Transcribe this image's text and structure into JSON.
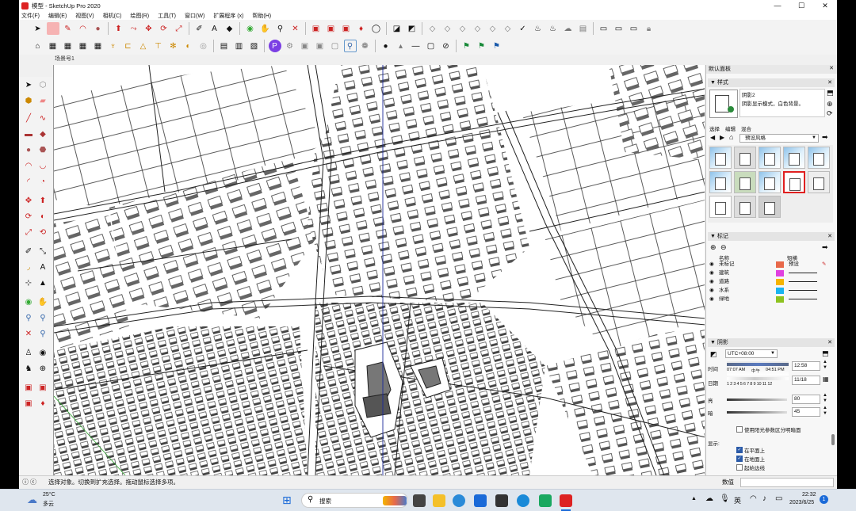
{
  "window": {
    "title": "模型 - SketchUp Pro 2020",
    "minimize": "—",
    "maximize": "☐",
    "close": "✕"
  },
  "menu": [
    "文件(F)",
    "编辑(E)",
    "视图(V)",
    "相机(C)",
    "绘图(R)",
    "工具(T)",
    "窗口(W)",
    "扩展程序 (x)",
    "帮助(H)"
  ],
  "scene_tab": "场景号1",
  "tray": {
    "title": "默认面板",
    "styles": {
      "header": "样式",
      "style_name": "阴影2",
      "style_desc": "阴影显示模式，白色背景。",
      "tabs": [
        "选择",
        "编辑",
        "混合"
      ],
      "collection": "预设风格"
    },
    "tags": {
      "header": "标记",
      "col_name": "名称",
      "col_dash": "短横",
      "rows": [
        {
          "name": "未标记",
          "color": "#e8694a",
          "dash": "预设"
        },
        {
          "name": "建筑",
          "color": "#e040e0",
          "dash": ""
        },
        {
          "name": "道路",
          "color": "#f5b400",
          "dash": ""
        },
        {
          "name": "水系",
          "color": "#19b4f0",
          "dash": ""
        },
        {
          "name": "绿地",
          "color": "#8dc21f",
          "dash": ""
        }
      ]
    },
    "shadows": {
      "header": "阴影",
      "timezone": "UTC+08:00",
      "time_label": "时间",
      "time_start": "07:07 AM",
      "time_mid": "中午",
      "time_end": "04:51 PM",
      "time_value": "12:58",
      "date_label": "日期",
      "months": "1 2 3 4 5 6 7 8 9 10 11 12",
      "date_value": "11/18",
      "light_label": "亮",
      "light_value": "80",
      "dark_label": "暗",
      "dark_value": "45",
      "use_sun": "使用阳光参数区分明暗面",
      "display_label": "显示:",
      "on_faces": "在平面上",
      "on_ground": "在地面上",
      "from_edges": "起始边线"
    }
  },
  "status": {
    "text": "选择对象。切换到扩充选择。拖动鼠标选择多项。",
    "measure_label": "数值"
  },
  "taskbar": {
    "weather_temp": "25°C",
    "weather_desc": "多云",
    "search": "搜索",
    "ime": "英",
    "time": "22:32",
    "date": "2023/6/25",
    "notif": "1"
  }
}
